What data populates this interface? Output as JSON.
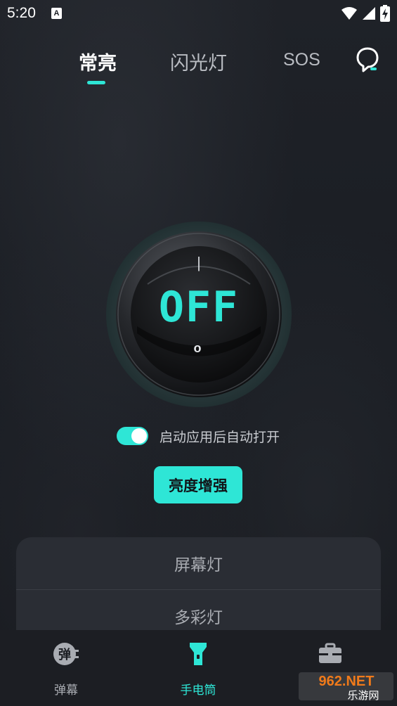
{
  "status_bar": {
    "time": "5:20",
    "notification_icon": "A",
    "icons": [
      "wifi-icon",
      "cell-signal-icon",
      "battery-charging-icon"
    ]
  },
  "top_tabs": [
    {
      "label": "常亮",
      "active": true
    },
    {
      "label": "闪光灯",
      "active": false
    },
    {
      "label": "SOS",
      "active": false
    }
  ],
  "help_icon": "help-chat-icon",
  "power_button": {
    "state_text": "OFF",
    "on_mark": "|",
    "off_mark": "o"
  },
  "auto_open": {
    "label": "启动应用后自动打开",
    "enabled": true
  },
  "boost_button": {
    "label": "亮度增强"
  },
  "modes": [
    {
      "label": "屏幕灯"
    },
    {
      "label": "多彩灯"
    }
  ],
  "bottom_nav": [
    {
      "label": "弹幕",
      "icon": "danmaku-icon",
      "icon_text": "弹",
      "active": false
    },
    {
      "label": "手电筒",
      "icon": "flashlight-icon",
      "active": true
    },
    {
      "label": "",
      "icon": "toolbox-icon",
      "active": false
    }
  ],
  "watermark": {
    "top": "962.NET",
    "bottom": "乐游网"
  },
  "colors": {
    "accent": "#2ee6d6",
    "background": "#1b1e24",
    "card": "#2a2d34"
  }
}
